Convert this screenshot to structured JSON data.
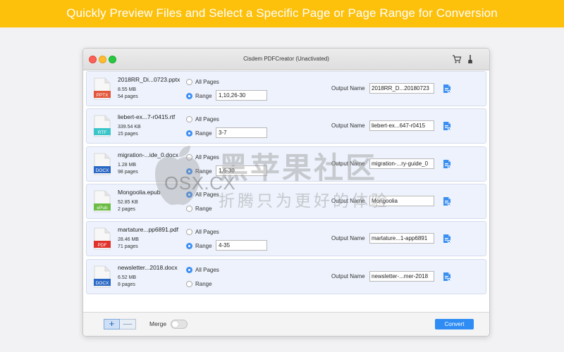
{
  "banner": {
    "text": "Quickly Preview Files and Select a Specific Page or Page Range for Conversion"
  },
  "window": {
    "title": "Cisdem PDFCreator (Unactivated)"
  },
  "labels": {
    "all_pages": "All Pages",
    "range": "Range",
    "output_name": "Output Name"
  },
  "files": [
    {
      "type": "PPTX",
      "color": "#e2573b",
      "name": "2018RR_Di...0723.pptx",
      "size": "8.55 MB",
      "pages": "54 pages",
      "mode": "range",
      "range": "1,10,26-30",
      "output": "2018RR_D...20180723"
    },
    {
      "type": "RTF",
      "color": "#3bc5c9",
      "name": "liebert-ex...7-r0415.rtf",
      "size": "339.54 KB",
      "pages": "15 pages",
      "mode": "range",
      "range": "3-7",
      "output": "liebert-ex...647-r0415"
    },
    {
      "type": "DOCX",
      "color": "#2a68c5",
      "name": "migration-...ide_0.docx",
      "size": "1.28 MB",
      "pages": "98 pages",
      "mode": "range",
      "range": "1,6-30",
      "output": "migration-...ry-guide_0"
    },
    {
      "type": "ePub",
      "color": "#6cbd45",
      "name": "Mongoolia.epub",
      "size": "52.85 KB",
      "pages": "2 pages",
      "mode": "all",
      "range": "",
      "output": "Mongoolia"
    },
    {
      "type": "PDF",
      "color": "#e0312b",
      "name": "martature...pp6891.pdf",
      "size": "28.46 MB",
      "pages": "71 pages",
      "mode": "range",
      "range": "4-35",
      "output": "martature...1-app6891"
    },
    {
      "type": "DOCX",
      "color": "#2a68c5",
      "name": "newsletter...2018.docx",
      "size": "6.52 MB",
      "pages": "8 pages",
      "mode": "all",
      "range": "",
      "output": "newsletter-...mer-2018"
    }
  ],
  "bottom": {
    "plus": "+",
    "minus": "—",
    "merge_label": "Merge",
    "convert_label": "Convert"
  },
  "watermark": {
    "site": "OSX.CX",
    "cn_title": "黑苹果社区",
    "cn_sub": "折腾只为更好的体验"
  },
  "colors": {
    "banner": "#fdc00b",
    "accent": "#2f8cf5",
    "row_bg": "#edf2fc"
  }
}
